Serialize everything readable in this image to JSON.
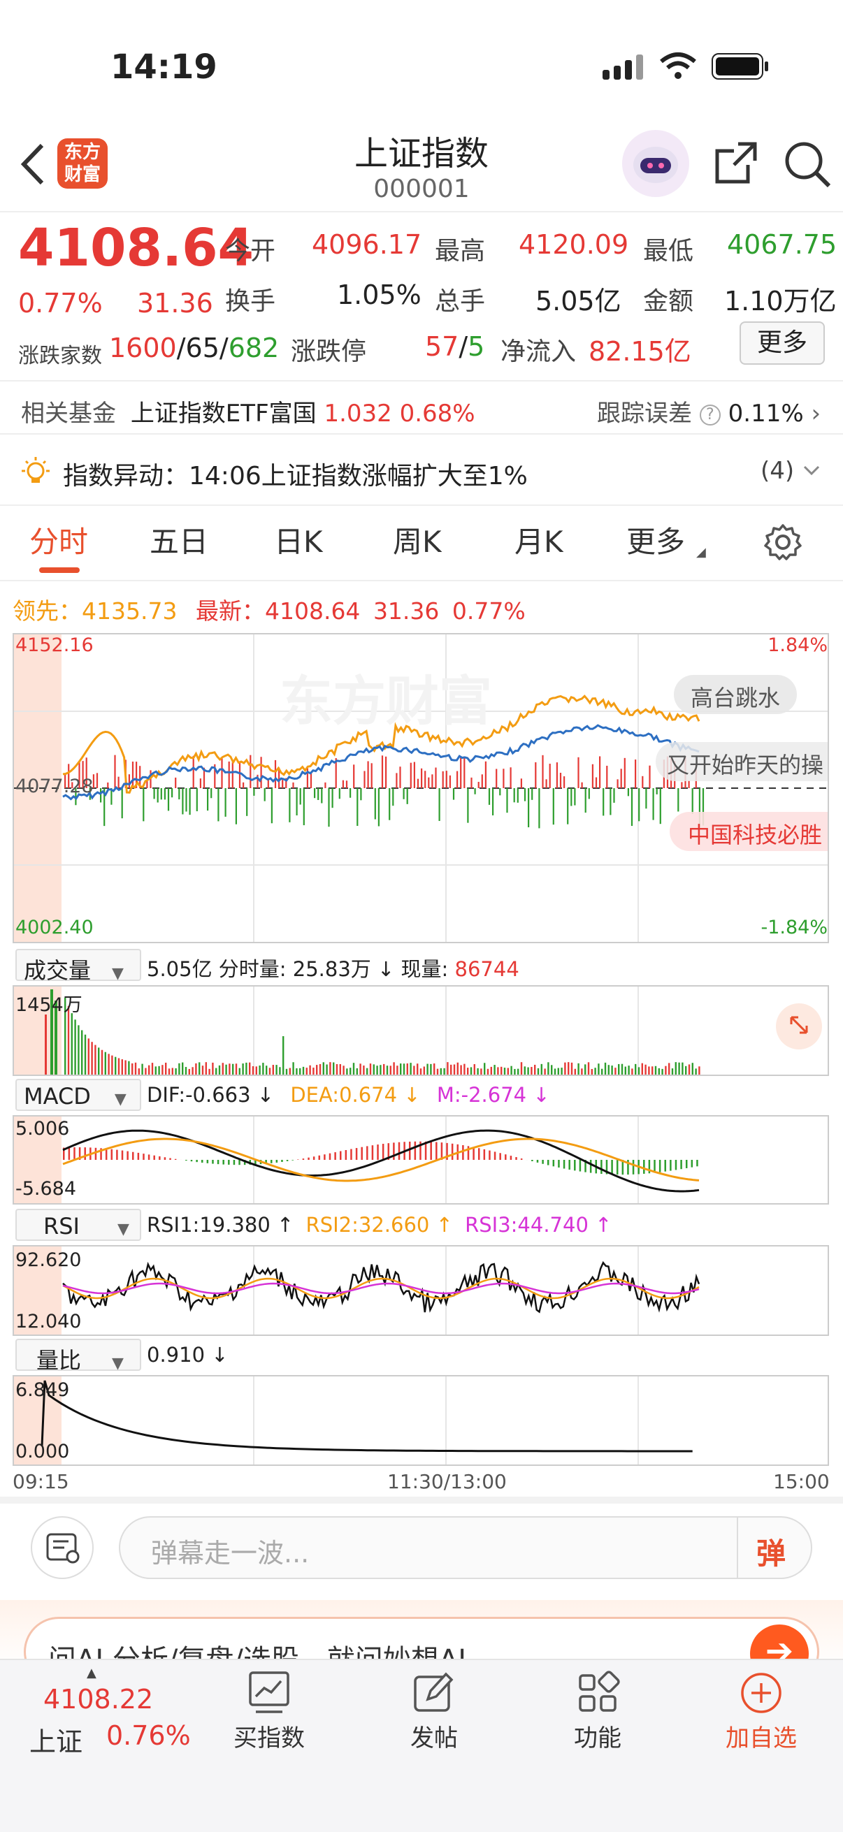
{
  "status_bar": {
    "time": "14:19"
  },
  "header": {
    "title": "上证指数",
    "code": "000001",
    "logo_text": "东方财富"
  },
  "quote": {
    "price": "4108.64",
    "pct": "0.77%",
    "change": "31.36",
    "open_label": "今开",
    "open": "4096.17",
    "high_label": "最高",
    "high": "4120.09",
    "low_label": "最低",
    "low": "4067.75",
    "turnover_label": "换手",
    "turnover": "1.05%",
    "vol_label": "总手",
    "vol": "5.05亿",
    "amount_label": "金额",
    "amount": "1.10万亿",
    "updown_label": "涨跌家数",
    "up": "1600",
    "flat": "65",
    "down": "682",
    "limit_label": "涨跌停",
    "limit_up": "57",
    "limit_down": "5",
    "netflow_label": "净流入",
    "netflow": "82.15亿",
    "more_button": "更多"
  },
  "fund": {
    "label": "相关基金",
    "name": "上证指数ETF富国",
    "price": "1.032",
    "pct": "0.68%",
    "err_label": "跟踪误差",
    "err_value": "0.11%"
  },
  "alert": {
    "text": "指数异动：14:06上证指数涨幅扩大至1%",
    "count": "(4)"
  },
  "tabs": [
    "分时",
    "五日",
    "日K",
    "周K",
    "月K",
    "更多"
  ],
  "intraday": {
    "lead_label": "领先：",
    "lead_value": "4135.73",
    "latest_label": "最新：",
    "latest_value": "4108.64",
    "latest_change": "31.36",
    "latest_pct": "0.77%",
    "y_top": "4152.16",
    "y_mid": "4077.28",
    "y_bottom": "4002.40",
    "pct_top": "1.84%",
    "pct_bottom": "-1.84%",
    "danmu": [
      "高台跳水",
      "又开始昨天的操",
      "中国科技必胜"
    ],
    "watermark": "东方财富"
  },
  "volume": {
    "label": "成交量",
    "info_prefix": "5.05亿 分时量: 25.83万 ↓ 现量: ",
    "current": "86744",
    "y_max": "1454万"
  },
  "macd": {
    "label": "MACD",
    "dif": "DIF:-0.663 ↓",
    "dea": "DEA:0.674 ↓",
    "m": "M:-2.674 ↓",
    "y_top": "5.006",
    "y_bottom": "-5.684"
  },
  "rsi": {
    "label": "RSI",
    "rsi1": "RSI1:19.380 ↑",
    "rsi2": "RSI2:32.660 ↑",
    "rsi3": "RSI3:44.740 ↑",
    "y_top": "92.620",
    "y_bottom": "12.040"
  },
  "volume_ratio": {
    "label": "量比",
    "value": "0.910 ↓",
    "y_top": "6.849",
    "y_bottom": "0.000"
  },
  "time_axis": {
    "start": "09:15",
    "mid": "11:30/13:00",
    "end": "15:00"
  },
  "comment": {
    "placeholder": "弹幕走一波...",
    "danmu_btn": "弹"
  },
  "ai_banner": {
    "text": "问AI  分析/复盘/选股，就问妙想AI"
  },
  "bottom_nav": {
    "index_value": "4108.22",
    "index_name": "上证",
    "index_pct": "0.76%",
    "items": [
      "买指数",
      "发帖",
      "功能",
      "加自选"
    ]
  }
}
